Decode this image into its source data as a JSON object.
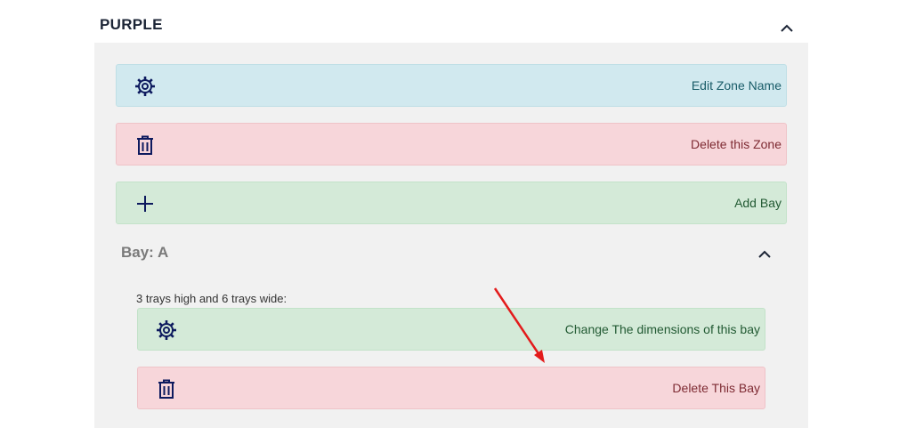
{
  "zone": {
    "title": "PURPLE",
    "actions": {
      "edit_label": "Edit Zone Name",
      "delete_label": "Delete this Zone",
      "add_bay_label": "Add Bay"
    }
  },
  "bay": {
    "title": "Bay: A",
    "dimensions_text": "3 trays high and 6 trays wide:",
    "actions": {
      "change_dimensions_label": "Change The dimensions of this bay",
      "delete_label": "Delete This Bay"
    }
  },
  "colors": {
    "icon": "#0d1a5e",
    "annotation_arrow": "#e31b1b",
    "info_bg": "#d1e9ef",
    "danger_bg": "#f7d6da",
    "success_bg": "#d4ead8"
  }
}
